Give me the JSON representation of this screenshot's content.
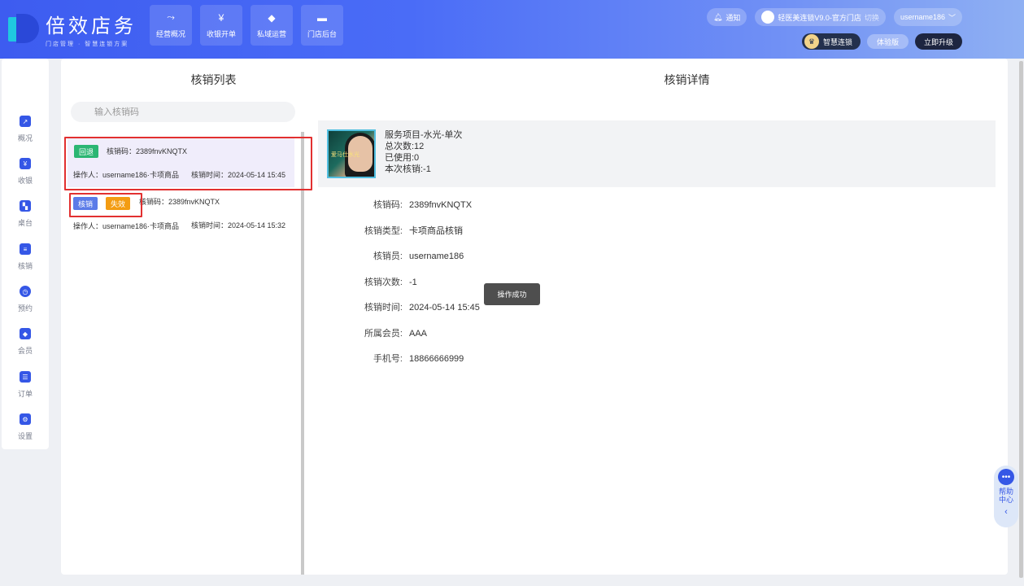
{
  "app": {
    "logo_title": "倍效店务",
    "logo_sub": "门店管理 · 智慧连锁方案"
  },
  "top_nav": [
    {
      "label": "经营概况",
      "icon": "trend-icon"
    },
    {
      "label": "收银开单",
      "icon": "cashier-icon"
    },
    {
      "label": "私域运营",
      "icon": "diamond-icon"
    },
    {
      "label": "门店后台",
      "icon": "store-icon"
    }
  ],
  "header": {
    "notify": "通知",
    "store_name": "轻医美连锁V9.0-官方门店",
    "switch": "切换",
    "username": "username186",
    "smart_chain": "智慧连锁",
    "trial": "体验版",
    "upgrade": "立即升级"
  },
  "sidebar": [
    {
      "label": "概况",
      "icon": "chart-icon"
    },
    {
      "label": "收银",
      "icon": "cashier-icon"
    },
    {
      "label": "桌台",
      "icon": "table-icon"
    },
    {
      "label": "核销",
      "icon": "verify-icon"
    },
    {
      "label": "预约",
      "icon": "clock-icon"
    },
    {
      "label": "会员",
      "icon": "vip-icon"
    },
    {
      "label": "订单",
      "icon": "order-icon"
    },
    {
      "label": "设置",
      "icon": "settings-icon"
    }
  ],
  "list": {
    "title": "核销列表",
    "search_placeholder": "输入核销码",
    "records": [
      {
        "tags": [
          "回退"
        ],
        "code": "核销码：2389fnvKNQTX",
        "operator": "操作人：username186·卡项商品",
        "time": "核销时间：2024-05-14 15:45"
      },
      {
        "tags": [
          "核销",
          "失效"
        ],
        "code": "核销码：2389fnvKNQTX",
        "operator": "操作人：username186·卡项商品",
        "time": "核销时间：2024-05-14 15:32"
      }
    ]
  },
  "detail": {
    "title": "核销详情",
    "product": {
      "name": "服务项目-水光-单次",
      "total": "总次数:12",
      "used": "已使用:0",
      "this_time": "本次核销:-1",
      "image_text": "爱马仕水光"
    },
    "fields": [
      {
        "k": "核销码:",
        "v": "2389fnvKNQTX"
      },
      {
        "k": "核销类型:",
        "v": "卡项商品核销"
      },
      {
        "k": "核销员:",
        "v": "username186"
      },
      {
        "k": "核销次数:",
        "v": "-1"
      },
      {
        "k": "核销时间:",
        "v": "2024-05-14 15:45"
      },
      {
        "k": "所属会员:",
        "v": "AAA"
      },
      {
        "k": "手机号:",
        "v": "18866666999"
      }
    ]
  },
  "toast": "操作成功",
  "help": {
    "line1": "帮助",
    "line2": "中心"
  }
}
